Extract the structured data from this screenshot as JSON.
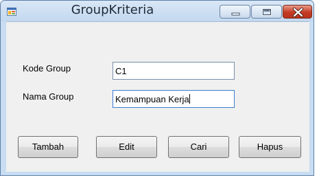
{
  "window": {
    "title": "GroupKriteria",
    "icon": "winforms-app-icon",
    "controls": {
      "minimize_icon": "minimize-icon",
      "maximize_icon": "maximize-icon",
      "close_icon": "close-icon"
    }
  },
  "form": {
    "kode_group_label": "Kode Group",
    "kode_group_value": "C1",
    "nama_group_label": "Nama Group",
    "nama_group_value": "Kemampuan Kerja"
  },
  "buttons": {
    "tambah": "Tambah",
    "edit": "Edit",
    "cari": "Cari",
    "hapus": "Hapus"
  },
  "colors": {
    "frame": "#c8ddf2",
    "client": "#f0f0f0",
    "close_button": "#c43b24"
  }
}
